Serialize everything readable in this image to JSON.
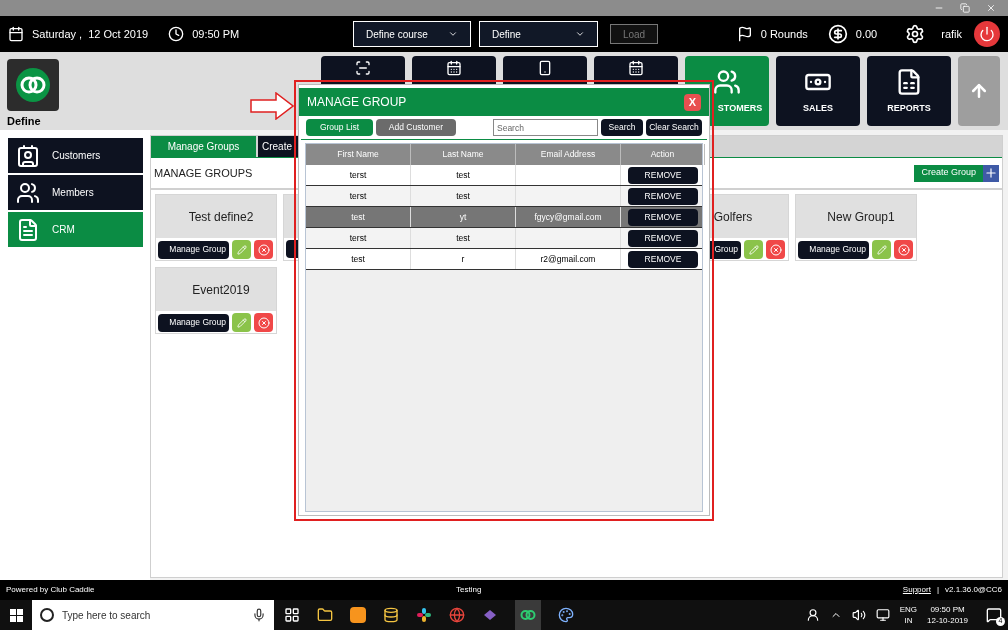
{
  "header": {
    "date": "Saturday ,  12 Oct 2019",
    "time": "09:50 PM",
    "course_select": "Define course",
    "define_select": "Define",
    "load_button": {
      "label": "Load",
      "disabled": true
    },
    "rounds": "0 Rounds",
    "balance": "0.00",
    "user": "rafik"
  },
  "brand": {
    "name": "Define"
  },
  "nav_tiles": [
    {
      "kind": "scanner",
      "selected": false
    },
    {
      "kind": "calendar",
      "selected": false
    },
    {
      "kind": "phone",
      "selected": false
    },
    {
      "kind": "calendar",
      "selected": false
    },
    {
      "kind": "customers",
      "label": "STOMERS",
      "selected": true
    },
    {
      "kind": "sales",
      "label": "SALES",
      "selected": false
    },
    {
      "kind": "reports",
      "label": "REPORTS",
      "selected": false
    },
    {
      "kind": "up",
      "selected": false
    }
  ],
  "sidebar": {
    "items": [
      {
        "kind": "customers",
        "label": "Customers",
        "selected": false
      },
      {
        "kind": "members",
        "label": "Members",
        "selected": false
      },
      {
        "kind": "crm",
        "label": "CRM",
        "selected": true
      }
    ]
  },
  "tabs": [
    {
      "label": "Manage Groups",
      "selected": true
    },
    {
      "label": "Create",
      "selected": false
    }
  ],
  "section_title": "MANAGE GROUPS",
  "create_button": "Create Group",
  "groups": [
    {
      "kind": "group",
      "title": "Test define2",
      "button": "Manage Group"
    },
    {
      "kind": "covered"
    },
    {
      "kind": "spacer"
    },
    {
      "kind": "spacer"
    },
    {
      "kind": "group",
      "title": "Golfers",
      "button": "Group"
    },
    {
      "kind": "group",
      "title": "New Group1",
      "button": "Manage Group"
    },
    {
      "kind": "group",
      "title": "Event2019",
      "button": "Manage Group"
    }
  ],
  "modal": {
    "title": "MANAGE GROUP",
    "close": "X",
    "group_list": "Group List",
    "add_customer": "Add Customer",
    "search_placeholder": "Search",
    "search_button": "Search",
    "clear_button": "Clear Search",
    "columns": [
      "First Name",
      "Last Name",
      "Email Address",
      "Action"
    ],
    "rows": [
      {
        "first_name": "terst",
        "last_name": "test",
        "action": "REMOVE",
        "selected": false
      },
      {
        "first_name": "terst",
        "last_name": "test",
        "action": "REMOVE",
        "selected": false
      },
      {
        "first_name": "test",
        "last_name": "yt",
        "email": "fgycy@gmail.com",
        "action": "REMOVE",
        "selected": true
      },
      {
        "first_name": "terst",
        "last_name": "test",
        "action": "REMOVE",
        "selected": false
      },
      {
        "first_name": "test",
        "last_name": "r",
        "email": "r2@gmail.com",
        "action": "REMOVE",
        "selected": false
      }
    ]
  },
  "footer": {
    "powered": "Powered by Club Caddie",
    "center": "Testing",
    "link": "Support",
    "separator": "|",
    "version": "v2.1.36.0@CC6"
  },
  "taskbar": {
    "search_placeholder": "Type here to search",
    "language": "ENG",
    "region": "IN",
    "time": "09:50 PM",
    "date": "12-10-2019",
    "notifications": "4"
  }
}
